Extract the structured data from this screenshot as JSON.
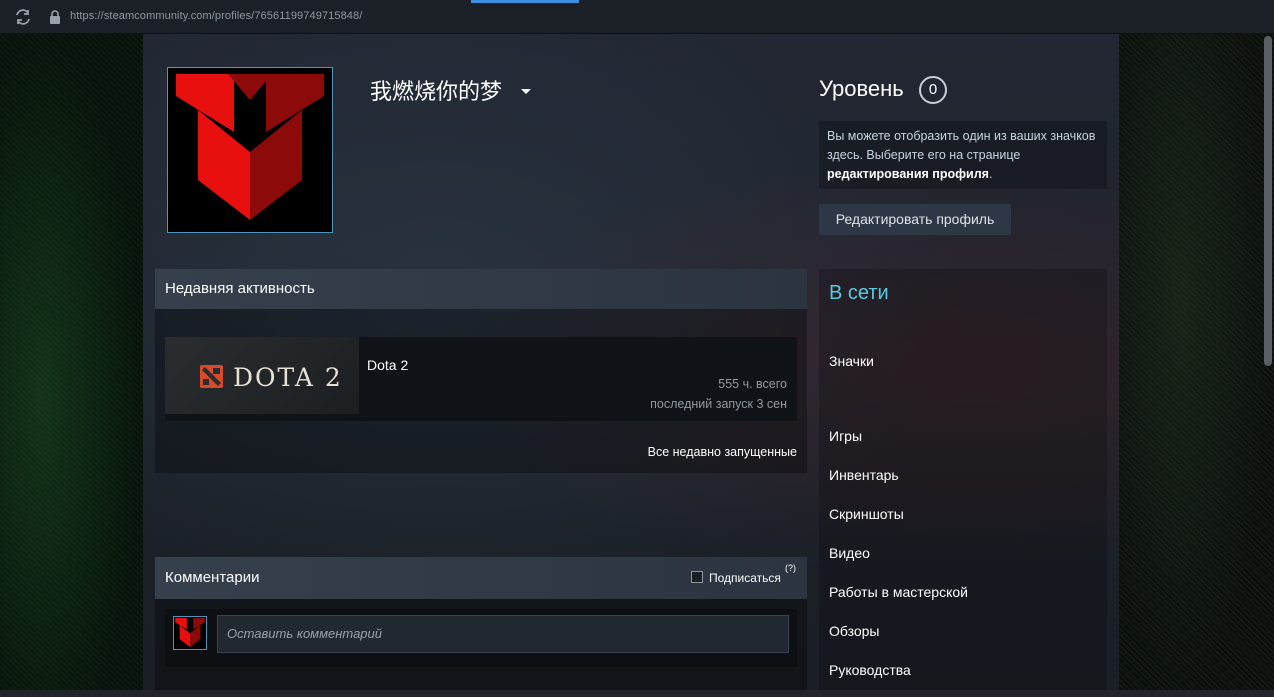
{
  "browser": {
    "url": "https://steamcommunity.com/profiles/76561199749715848/",
    "icons": [
      "reload-icon",
      "lock-icon"
    ]
  },
  "profile": {
    "persona_name": "我燃烧你的梦",
    "level_label": "Уровень",
    "level_value": "0",
    "badge_text_1": "Вы можете отобразить один из ваших значков здесь. Выберите его на странице ",
    "badge_text_link": "редактирования профиля",
    "badge_text_end": ".",
    "edit_button": "Редактировать профиль"
  },
  "activity": {
    "title": "Недавняя активность",
    "game": {
      "logo_text": "DOTA 2",
      "name": "Dota 2",
      "hours": "555 ч. всего",
      "last_played": "последний запуск 3 сен"
    },
    "all_recent": "Все недавно запущенные"
  },
  "comments": {
    "title": "Комментарии",
    "subscribe": "Подписаться",
    "help": "(?)",
    "placeholder": "Оставить комментарий"
  },
  "sidebar": {
    "status": "В сети",
    "badges": "Значки",
    "items": [
      "Игры",
      "Инвентарь",
      "Скриншоты",
      "Видео",
      "Работы в мастерской",
      "Обзоры",
      "Руководства"
    ]
  },
  "colors": {
    "status_online": "#57cbde",
    "avatar_red": "#e8100f",
    "avatar_dark_red": "#8c0a0a",
    "accent_blue": "#3d8fe0"
  }
}
